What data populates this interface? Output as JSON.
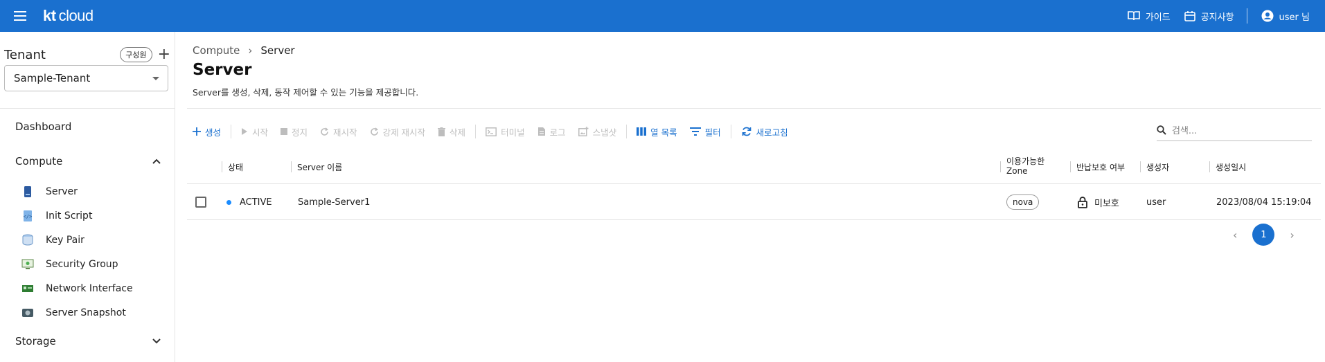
{
  "header": {
    "logo_kt": "kt",
    "logo_cloud": "cloud",
    "links": [
      {
        "label": "가이드",
        "icon": "book-icon"
      },
      {
        "label": "공지사항",
        "icon": "calendar-icon"
      }
    ],
    "user_label": "user 님",
    "brand_color": "#1a70cf"
  },
  "sidebar": {
    "tenant_title": "Tenant",
    "member_button": "구성원",
    "tenant_selected": "Sample-Tenant",
    "dashboard": "Dashboard",
    "compute_head": "Compute",
    "compute_items": [
      {
        "label": "Server",
        "icon": "server-icon"
      },
      {
        "label": "Init Script",
        "icon": "script-icon"
      },
      {
        "label": "Key Pair",
        "icon": "key-pair-icon"
      },
      {
        "label": "Security Group",
        "icon": "security-group-icon"
      },
      {
        "label": "Network Interface",
        "icon": "network-interface-icon"
      },
      {
        "label": "Server Snapshot",
        "icon": "snapshot-icon"
      }
    ],
    "storage_head": "Storage"
  },
  "main": {
    "breadcrumb": [
      "Compute",
      "Server"
    ],
    "title": "Server",
    "description": "Server를 생성, 삭제, 동작 제어할 수 있는 기능을 제공합니다.",
    "toolbar": {
      "create": "생성",
      "start": "시작",
      "stop": "정지",
      "restart": "재시작",
      "force_restart": "강제 재시작",
      "delete": "삭제",
      "terminal": "터미널",
      "log": "로그",
      "snapshot": "스냅샷",
      "columns": "열 목록",
      "filter": "필터",
      "refresh": "새로고침"
    },
    "search_placeholder": "검색...",
    "columns": {
      "status": "상태",
      "name": "Server 이름",
      "zone_line1": "이용가능한",
      "zone_line2": "Zone",
      "protection": "반납보호 여부",
      "creator": "생성자",
      "created": "생성일시"
    },
    "rows": [
      {
        "status": "ACTIVE",
        "name": "Sample-Server1",
        "zone": "nova",
        "protection": "미보호",
        "creator": "user",
        "created": "2023/08/04 15:19:04"
      }
    ],
    "pagination": {
      "current": "1"
    }
  }
}
